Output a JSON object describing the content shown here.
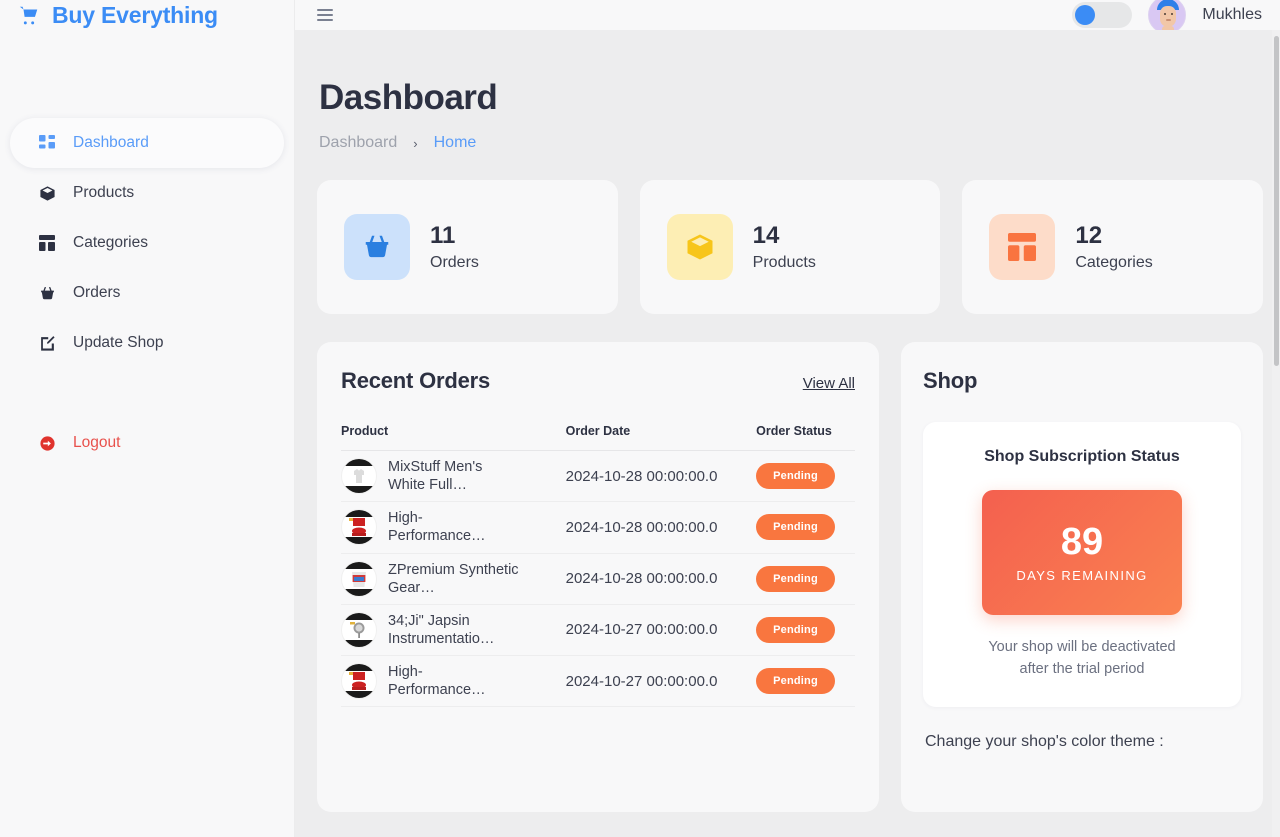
{
  "brand": {
    "name": "Buy Everything",
    "icon": "shopping-cart-icon"
  },
  "topbar": {
    "menu_icon": "hamburger-menu-icon",
    "theme_toggle": "theme-toggle",
    "username": "Mukhles",
    "avatar": "user-avatar"
  },
  "sidebar": {
    "items": [
      {
        "label": "Dashboard",
        "icon": "grid-dashboard-icon",
        "active": true
      },
      {
        "label": "Products",
        "icon": "box-icon",
        "active": false
      },
      {
        "label": "Categories",
        "icon": "layout-grid-icon",
        "active": false
      },
      {
        "label": "Orders",
        "icon": "basket-icon",
        "active": false
      },
      {
        "label": "Update Shop",
        "icon": "edit-square-icon",
        "active": false
      }
    ],
    "logout": {
      "label": "Logout",
      "icon": "logout-icon"
    }
  },
  "page": {
    "title": "Dashboard",
    "breadcrumb": {
      "parent": "Dashboard",
      "separator": "›",
      "current": "Home"
    }
  },
  "stats": [
    {
      "value": "11",
      "label": "Orders",
      "icon": "basket-icon",
      "bg": "#cce1fb",
      "fg": "#2a7fe0"
    },
    {
      "value": "14",
      "label": "Products",
      "icon": "box-icon",
      "bg": "#fdeeb4",
      "fg": "#f7c51a"
    },
    {
      "value": "12",
      "label": "Categories",
      "icon": "layout-grid-icon",
      "bg": "#fddcc9",
      "fg": "#f97440"
    }
  ],
  "recent_orders": {
    "title": "Recent Orders",
    "view_all": "View All",
    "columns": [
      "Product",
      "Order Date",
      "Order Status"
    ],
    "rows": [
      {
        "product": "MixStuff Men's White Full…",
        "date": "2024-10-28 00:00:00.0",
        "status": "Pending",
        "thumb": "shirt-thumbnail"
      },
      {
        "product": "High-Performance…",
        "date": "2024-10-28 00:00:00.0",
        "status": "Pending",
        "thumb": "red-machine-thumbnail"
      },
      {
        "product": "ZPremium Synthetic Gear…",
        "date": "2024-10-28 00:00:00.0",
        "status": "Pending",
        "thumb": "bucket-thumbnail"
      },
      {
        "product": "34;Ji\" Japsin Instrumentatio…",
        "date": "2024-10-27 00:00:00.0",
        "status": "Pending",
        "thumb": "gauge-thumbnail"
      },
      {
        "product": "High-Performance…",
        "date": "2024-10-27 00:00:00.0",
        "status": "Pending",
        "thumb": "red-machine-thumbnail"
      }
    ]
  },
  "shop": {
    "title": "Shop",
    "subscription_title": "Shop Subscription Status",
    "days_remaining": "89",
    "days_label": "DAYS REMAINING",
    "note_line1": "Your shop will be deactivated",
    "note_line2": "after the trial period",
    "theme_label": "Change your shop's color theme :"
  },
  "colors": {
    "brand_blue": "#3b8cf5",
    "accent_orange": "#f9763f",
    "logout_red": "#e8514c",
    "page_bg": "#ededee",
    "card_bg": "#f8f8f9"
  }
}
